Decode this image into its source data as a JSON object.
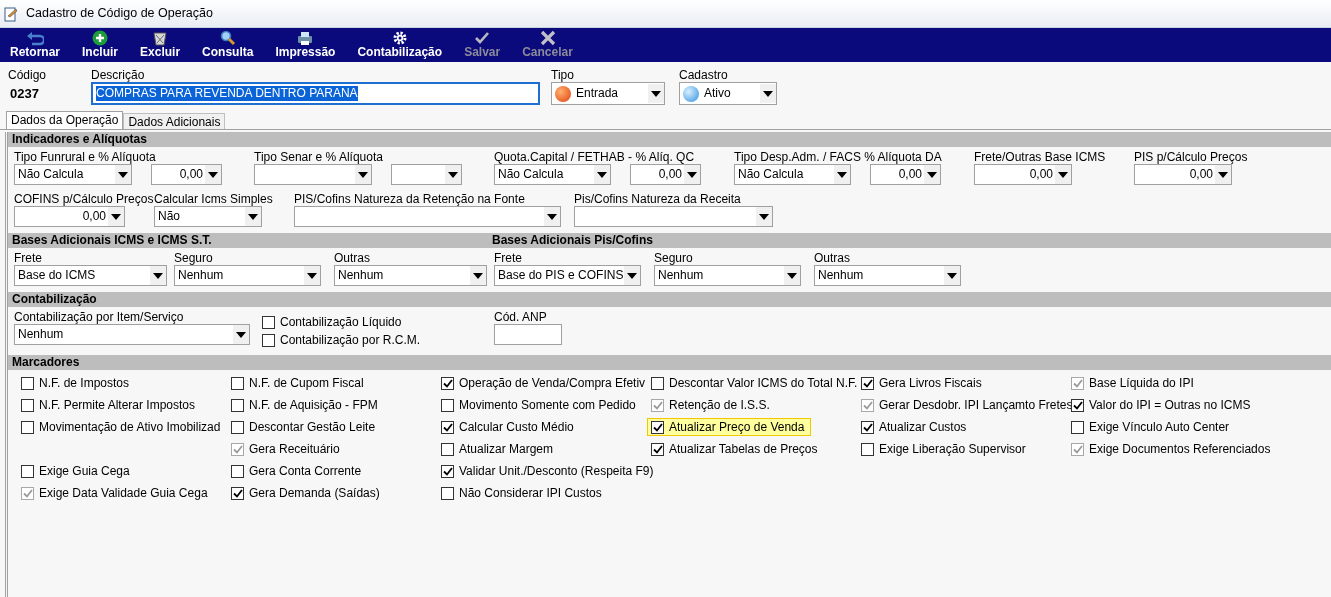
{
  "window": {
    "title": "Cadastro de Código de Operação"
  },
  "toolbar": [
    {
      "label": "Retornar",
      "disabled": false
    },
    {
      "label": "Incluir",
      "disabled": false
    },
    {
      "label": "Excluir",
      "disabled": false
    },
    {
      "label": "Consulta",
      "disabled": false
    },
    {
      "label": "Impressão",
      "disabled": false
    },
    {
      "label": "Contabilização",
      "disabled": false
    },
    {
      "label": "Salvar",
      "disabled": true
    },
    {
      "label": "Cancelar",
      "disabled": true
    }
  ],
  "header": {
    "codigo": {
      "label": "Código",
      "value": "0237"
    },
    "descricao": {
      "label": "Descrição",
      "value": "COMPRAS PARA REVENDA DENTRO PARANA",
      "selected": true
    },
    "tipo": {
      "label": "Tipo",
      "value": "Entrada"
    },
    "cadastro": {
      "label": "Cadastro",
      "value": "Ativo"
    }
  },
  "tabs": [
    {
      "label": "Dados da Operação",
      "selected": true
    },
    {
      "label": "Dados Adicionais",
      "selected": false
    }
  ],
  "sections": [
    {
      "titles": [
        "Indicadores e Alíquotas"
      ],
      "fields": [
        {
          "label": "Tipo Funrural e % Alíquota",
          "controls": [
            {
              "kind": "select",
              "value": "Não Calcula"
            },
            {
              "kind": "number",
              "value": "0,00"
            }
          ]
        },
        {
          "label": "Tipo Senar e % Alíquota",
          "controls": [
            {
              "kind": "select"
            },
            {
              "kind": "select"
            }
          ]
        },
        {
          "label": "Quota.Capital / FETHAB - % Alíq. QC",
          "controls": [
            {
              "kind": "select",
              "value": "Não Calcula"
            },
            {
              "kind": "number",
              "value": "0,00"
            }
          ]
        },
        {
          "label": "Tipo Desp.Adm. / FACS % Alíquota DA",
          "controls": [
            {
              "kind": "select",
              "value": "Não Calcula"
            },
            {
              "kind": "number",
              "value": "0,00"
            }
          ]
        },
        {
          "label": "Frete/Outras Base ICMS",
          "controls": [
            {
              "kind": "number",
              "value": "0,00"
            }
          ]
        },
        {
          "label": "PIS p/Cálculo Preços",
          "controls": [
            {
              "kind": "number",
              "value": "0,00"
            }
          ]
        },
        {
          "label": "COFINS p/Cálculo Preços",
          "controls": [
            {
              "kind": "number",
              "value": "0,00"
            }
          ]
        },
        {
          "label": "Calcular Icms Simples",
          "controls": [
            {
              "kind": "select",
              "value": "Não"
            }
          ]
        },
        {
          "label": "PIS/Cofins Natureza da Retenção na Fonte",
          "controls": [
            {
              "kind": "select"
            }
          ]
        },
        {
          "label": "Pis/Cofins Natureza da Receita",
          "controls": [
            {
              "kind": "select"
            }
          ]
        }
      ]
    },
    {
      "titles": [
        "Bases Adicionais ICMS e ICMS S.T.",
        "Bases Adicionais Pis/Cofins"
      ],
      "fields": [
        {
          "label": "Frete",
          "controls": [
            {
              "kind": "select",
              "value": "Base do ICMS"
            }
          ]
        },
        {
          "label": "Seguro",
          "controls": [
            {
              "kind": "select",
              "value": "Nenhum"
            }
          ]
        },
        {
          "label": "Outras",
          "controls": [
            {
              "kind": "select",
              "value": "Nenhum"
            }
          ]
        },
        {
          "label": "Frete",
          "controls": [
            {
              "kind": "select",
              "value": "Base do PIS e COFINS"
            }
          ]
        },
        {
          "label": "Seguro",
          "controls": [
            {
              "kind": "select",
              "value": "Nenhum"
            }
          ]
        },
        {
          "label": "Outras",
          "controls": [
            {
              "kind": "select",
              "value": "Nenhum"
            }
          ]
        }
      ]
    },
    {
      "titles": [
        "Contabilização"
      ],
      "fields": [
        {
          "label": "Contabilização por Item/Serviço",
          "controls": [
            {
              "kind": "select",
              "value": "Nenhum"
            }
          ]
        },
        {
          "controls": [
            {
              "kind": "checkbox",
              "label": "Contabilização Líquido",
              "checked": false
            },
            {
              "kind": "checkbox",
              "label": "Contabilização por R.C.M.",
              "checked": false
            }
          ]
        },
        {
          "label": "Cód. ANP",
          "controls": [
            {
              "kind": "text"
            }
          ]
        }
      ]
    }
  ],
  "marcadores": {
    "title": "Marcadores",
    "columns": [
      {
        "items": [
          {
            "kind": "checkbox",
            "label": "N.F. de Impostos",
            "checked": false,
            "disabled": false
          },
          {
            "kind": "checkbox",
            "label": "N.F. Permite Alterar Impostos",
            "checked": false,
            "disabled": false
          },
          {
            "kind": "checkbox",
            "label": "Movimentação de Ativo Imobilizad",
            "checked": false,
            "disabled": false
          },
          {
            "kind": "spacer"
          },
          {
            "kind": "checkbox",
            "label": "Exige Guia Cega",
            "checked": false,
            "disabled": false
          },
          {
            "kind": "checkbox",
            "label": "Exige Data Validade Guia Cega",
            "checked": true,
            "disabled": true
          }
        ]
      },
      {
        "items": [
          {
            "kind": "checkbox",
            "label": "N.F. de Cupom Fiscal",
            "checked": false,
            "disabled": false
          },
          {
            "kind": "checkbox",
            "label": "N.F. de Aquisição - FPM",
            "checked": false,
            "disabled": false
          },
          {
            "kind": "checkbox",
            "label": "Descontar Gestão Leite",
            "checked": false,
            "disabled": false
          },
          {
            "kind": "checkbox",
            "label": "Gera Receituário",
            "checked": true,
            "disabled": true
          },
          {
            "kind": "checkbox",
            "label": "Gera Conta Corrente",
            "checked": false,
            "disabled": false
          },
          {
            "kind": "checkbox",
            "label": "Gera Demanda (Saídas)",
            "checked": true,
            "disabled": false
          }
        ]
      },
      {
        "items": [
          {
            "kind": "checkbox",
            "label": "Operação de Venda/Compra Efetiv",
            "checked": true,
            "disabled": false
          },
          {
            "kind": "checkbox",
            "label": "Movimento Somente com Pedido",
            "checked": false,
            "disabled": false
          },
          {
            "kind": "checkbox",
            "label": "Calcular Custo Médio",
            "checked": true,
            "disabled": false
          },
          {
            "kind": "checkbox",
            "label": "Atualizar Margem",
            "checked": false,
            "disabled": false
          },
          {
            "kind": "checkbox",
            "label": "Validar Unit./Desconto (Respeita F9)",
            "checked": true,
            "disabled": false
          },
          {
            "kind": "checkbox",
            "label": "Não Considerar IPI Custos",
            "checked": false,
            "disabled": false
          }
        ]
      },
      {
        "items": [
          {
            "kind": "checkbox",
            "label": "Descontar Valor ICMS do Total N.F.",
            "checked": false,
            "disabled": false
          },
          {
            "kind": "checkbox",
            "label": "Retenção de I.S.S.",
            "checked": true,
            "disabled": true
          },
          {
            "kind": "checkbox",
            "label": "Atualizar Preço de Venda",
            "checked": true,
            "disabled": false,
            "highlighted": true
          },
          {
            "kind": "checkbox",
            "label": "Atualizar Tabelas de Preços",
            "checked": true,
            "disabled": false
          }
        ]
      },
      {
        "items": [
          {
            "kind": "checkbox",
            "label": "Gera Livros Fiscais",
            "checked": true,
            "disabled": false
          },
          {
            "kind": "checkbox",
            "label": "Gerar Desdobr. IPI Lançamto Fretes",
            "checked": true,
            "disabled": true
          },
          {
            "kind": "checkbox",
            "label": "Atualizar Custos",
            "checked": true,
            "disabled": false
          },
          {
            "kind": "checkbox",
            "label": "Exige Liberação Supervisor",
            "checked": false,
            "disabled": false
          }
        ]
      },
      {
        "items": [
          {
            "kind": "checkbox",
            "label": "Base Líquida do IPI",
            "checked": true,
            "disabled": true
          },
          {
            "kind": "checkbox",
            "label": "Valor do IPI = Outras no ICMS",
            "checked": true,
            "disabled": false
          },
          {
            "kind": "checkbox",
            "label": "Exige Vínculo Auto Center",
            "checked": false,
            "disabled": false
          },
          {
            "kind": "checkbox",
            "label": "Exige Documentos Referenciados",
            "checked": true,
            "disabled": true
          }
        ]
      }
    ]
  }
}
